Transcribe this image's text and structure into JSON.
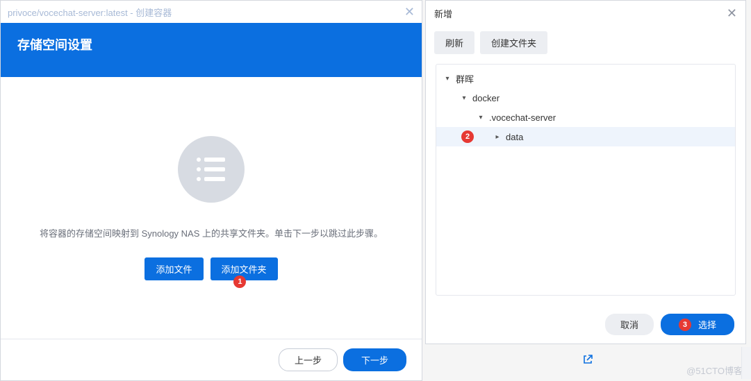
{
  "left": {
    "titlebar": "privoce/vocechat-server:latest - 创建容器",
    "header": "存储空间设置",
    "description": "将容器的存储空间映射到 Synology NAS 上的共享文件夹。单击下一步以跳过此步骤。",
    "add_file": "添加文件",
    "add_folder": "添加文件夹",
    "prev": "上一步",
    "next": "下一步"
  },
  "right": {
    "title": "新增",
    "refresh": "刷新",
    "create_folder": "创建文件夹",
    "cancel": "取消",
    "select": "选择",
    "tree": {
      "root": "群晖",
      "n1": "docker",
      "n2": ".vocechat-server",
      "n3": "data"
    }
  },
  "annotations": {
    "a1": "1",
    "a2": "2",
    "a3": "3"
  },
  "watermark": "@51CTO博客"
}
